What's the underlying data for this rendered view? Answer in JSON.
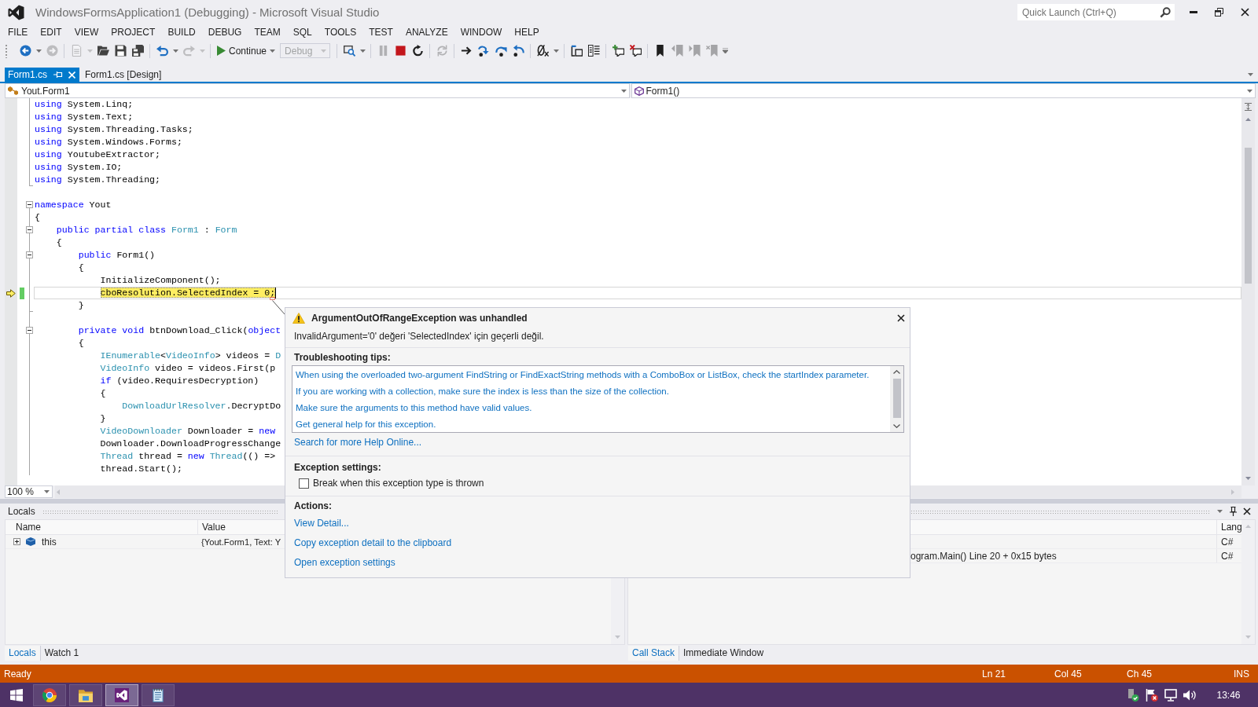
{
  "window": {
    "title": "WindowsFormsApplication1 (Debugging) - Microsoft Visual Studio",
    "quick_launch": {
      "placeholder": "Quick Launch (Ctrl+Q)"
    }
  },
  "menu": [
    "FILE",
    "EDIT",
    "VIEW",
    "PROJECT",
    "BUILD",
    "DEBUG",
    "TEAM",
    "SQL",
    "TOOLS",
    "TEST",
    "ANALYZE",
    "WINDOW",
    "HELP"
  ],
  "toolbar": {
    "buttons": [
      {
        "disabled": false
      },
      {
        "disabled": true
      },
      {
        "disabled": true
      },
      {
        "disabled": false
      },
      {
        "disabled": false
      },
      {
        "disabled": false
      },
      {
        "disabled": false
      },
      {
        "disabled": true
      },
      {
        "disabled": false
      },
      {
        "disabled": true
      },
      {
        "disabled": false
      },
      {
        "disabled": false
      },
      {
        "disabled": true
      },
      {
        "disabled": false
      },
      {
        "disabled": false
      },
      {
        "disabled": false
      },
      {
        "disabled": false
      },
      {
        "disabled": false
      },
      {
        "disabled": false
      },
      {
        "disabled": false
      },
      {
        "disabled": false
      },
      {
        "disabled": false
      },
      {
        "disabled": false
      },
      {
        "disabled": true
      },
      {
        "disabled": true
      },
      {
        "disabled": true
      }
    ],
    "continue_button": {
      "label": "Continue"
    },
    "configuration": {
      "value": "Debug",
      "disabled": true
    }
  },
  "document_tabs": [
    {
      "label": "Form1.cs",
      "selected": true
    },
    {
      "label": "Form1.cs [Design]",
      "selected": false
    }
  ],
  "navigation_bar": {
    "type": "Yout.Form1",
    "member": "Form1()"
  },
  "editor": {
    "lines": [
      {
        "kind": "inner",
        "tokens": [
          {
            "kind": "keyword",
            "text": "using"
          },
          {
            "kind": "plain",
            "text": " System.Linq;"
          }
        ],
        "current": false
      },
      {
        "kind": "inner",
        "tokens": [
          {
            "kind": "keyword",
            "text": "using"
          },
          {
            "kind": "plain",
            "text": " System.Text;"
          }
        ],
        "current": false
      },
      {
        "kind": "inner",
        "tokens": [
          {
            "kind": "keyword",
            "text": "using"
          },
          {
            "kind": "plain",
            "text": " System.Threading.Tasks;"
          }
        ],
        "current": false
      },
      {
        "kind": "inner",
        "tokens": [
          {
            "kind": "keyword",
            "text": "using"
          },
          {
            "kind": "plain",
            "text": " System.Windows.Forms;"
          }
        ],
        "current": false
      },
      {
        "kind": "inner",
        "tokens": [
          {
            "kind": "keyword",
            "text": "using"
          },
          {
            "kind": "plain",
            "text": " YoutubeExtractor;"
          }
        ],
        "current": false
      },
      {
        "kind": "inner",
        "tokens": [
          {
            "kind": "keyword",
            "text": "using"
          },
          {
            "kind": "plain",
            "text": " System.IO;"
          }
        ],
        "current": false
      },
      {
        "kind": "close",
        "tokens": [
          {
            "kind": "keyword",
            "text": "using"
          },
          {
            "kind": "plain",
            "text": " System.Threading;"
          }
        ],
        "current": false
      },
      {
        "kind": "outer",
        "current": false
      },
      {
        "kind": "open",
        "tokens": [
          {
            "kind": "keyword",
            "text": "namespace"
          },
          {
            "kind": "plain",
            "text": " Yout"
          }
        ],
        "expanded": true,
        "current": false
      },
      {
        "kind": "inner",
        "tokens": [
          {
            "kind": "plain",
            "text": "{"
          }
        ],
        "current": false
      },
      {
        "kind": "open",
        "tokens": [
          {
            "kind": "keyword",
            "text": "    public"
          },
          {
            "kind": "keyword",
            "text": " partial"
          },
          {
            "kind": "keyword",
            "text": " class"
          },
          {
            "kind": "type",
            "text": " Form1"
          },
          {
            "kind": "plain",
            "text": " : "
          },
          {
            "kind": "type",
            "text": "Form"
          }
        ],
        "expanded": true,
        "current": false
      },
      {
        "kind": "inner",
        "tokens": [
          {
            "kind": "plain",
            "text": "    {"
          }
        ],
        "current": false
      },
      {
        "kind": "open",
        "tokens": [
          {
            "kind": "keyword",
            "text": "        public"
          },
          {
            "kind": "plain",
            "text": " Form1()"
          }
        ],
        "expanded": true,
        "current": false
      },
      {
        "kind": "inner",
        "tokens": [
          {
            "kind": "plain",
            "text": "        {"
          }
        ],
        "current": false
      },
      {
        "kind": "inner",
        "tokens": [
          {
            "kind": "plain",
            "text": "            InitializeComponent();"
          }
        ],
        "current": false
      },
      {
        "kind": "inner",
        "tokens": [
          {
            "kind": "plain",
            "text": "            cboResolution.SelectedIndex = 0;"
          }
        ],
        "current": true,
        "changed": true
      },
      {
        "kind": "close",
        "tokens": [
          {
            "kind": "plain",
            "text": "        }"
          }
        ],
        "current": false
      },
      {
        "kind": "inner",
        "current": false
      },
      {
        "kind": "open",
        "tokens": [
          {
            "kind": "keyword",
            "text": "        private"
          },
          {
            "kind": "keyword",
            "text": " void"
          },
          {
            "kind": "plain",
            "text": " btnDownload_Click("
          },
          {
            "kind": "keyword",
            "text": "object"
          }
        ],
        "expanded": true,
        "current": false
      },
      {
        "kind": "inner",
        "tokens": [
          {
            "kind": "plain",
            "text": "        {"
          }
        ],
        "current": false
      },
      {
        "kind": "inner",
        "tokens": [
          {
            "kind": "type",
            "text": "            IEnumerable"
          },
          {
            "kind": "plain",
            "text": "<"
          },
          {
            "kind": "type",
            "text": "VideoInfo"
          },
          {
            "kind": "plain",
            "text": "> videos = "
          },
          {
            "kind": "type",
            "text": "D"
          }
        ],
        "current": false
      },
      {
        "kind": "inner",
        "tokens": [
          {
            "kind": "type",
            "text": "            VideoInfo"
          },
          {
            "kind": "plain",
            "text": " video = videos.First(p"
          }
        ],
        "current": false
      },
      {
        "kind": "inner",
        "tokens": [
          {
            "kind": "keyword",
            "text": "            if"
          },
          {
            "kind": "plain",
            "text": " (video.RequiresDecryption)"
          }
        ],
        "current": false
      },
      {
        "kind": "inner",
        "tokens": [
          {
            "kind": "plain",
            "text": "            {"
          }
        ],
        "current": false
      },
      {
        "kind": "inner",
        "tokens": [
          {
            "kind": "type",
            "text": "                DownloadUrlResolver"
          },
          {
            "kind": "plain",
            "text": ".DecryptDo"
          }
        ],
        "current": false
      },
      {
        "kind": "inner",
        "tokens": [
          {
            "kind": "plain",
            "text": "            }"
          }
        ],
        "current": false
      },
      {
        "kind": "inner",
        "tokens": [
          {
            "kind": "type",
            "text": "            VideoDownloader"
          },
          {
            "kind": "plain",
            "text": " Downloader = "
          },
          {
            "kind": "keyword",
            "text": "new"
          }
        ],
        "current": false
      },
      {
        "kind": "inner",
        "tokens": [
          {
            "kind": "plain",
            "text": "            Downloader.DownloadProgressChange"
          }
        ],
        "current": false
      },
      {
        "kind": "inner",
        "tokens": [
          {
            "kind": "type",
            "text": "            Thread"
          },
          {
            "kind": "plain",
            "text": " thread = "
          },
          {
            "kind": "keyword",
            "text": "new"
          },
          {
            "kind": "type",
            "text": " Thread"
          },
          {
            "kind": "plain",
            "text": "(() =>"
          }
        ],
        "current": false
      },
      {
        "kind": "inner",
        "tokens": [
          {
            "kind": "plain",
            "text": "            thread.Start();"
          }
        ],
        "current": false
      }
    ],
    "zoom": "100 %"
  },
  "exception_popup": {
    "title": "ArgumentOutOfRangeException was unhandled",
    "message": "InvalidArgument='0' değeri 'SelectedIndex' için geçerli değil.",
    "tips_heading": "Troubleshooting tips:",
    "tips": [
      "When using the overloaded two-argument FindString or FindExactString methods with a ComboBox or ListBox, check the startIndex parameter.",
      "If you are working with a collection, make sure the index is less than the size of the collection.",
      "Make sure the arguments to this method have valid values.",
      "Get general help for this exception."
    ],
    "help_link": "Search for more Help Online...",
    "settings_heading": "Exception settings:",
    "break_option": {
      "label": "Break when this exception type is thrown",
      "checked": false
    },
    "actions_heading": "Actions:",
    "actions": [
      "View Detail...",
      "Copy exception detail to the clipboard",
      "Open exception settings"
    ]
  },
  "locals_panel": {
    "title": "Locals",
    "columns": [
      "Name",
      "Value"
    ],
    "rows": [
      {
        "name": "this",
        "value": "{Yout.Form1, Text: Y",
        "expanded": false
      }
    ],
    "tabs": [
      {
        "label": "Locals",
        "selected": true
      },
      {
        "label": "Watch 1",
        "selected": false
      }
    ]
  },
  "call_stack_panel": {
    "columns": [
      "Lang"
    ],
    "rows": [
      {
        "lang": "C#"
      },
      {
        "column_1": "ogram.Main() Line 20 + 0x15 bytes",
        "lang": "C#"
      }
    ],
    "tabs": [
      {
        "label": "Call Stack",
        "selected": true
      },
      {
        "label": "Immediate Window",
        "selected": false
      }
    ]
  },
  "status_bar": {
    "message": "Ready",
    "line": "Ln 21",
    "column": "Col 45",
    "character": "Ch 45",
    "mode": "INS"
  },
  "taskbar": {
    "apps": [
      {
        "selected": false
      },
      {
        "selected": false
      },
      {
        "selected": true
      },
      {
        "selected": false
      }
    ],
    "clock": "13:46"
  }
}
